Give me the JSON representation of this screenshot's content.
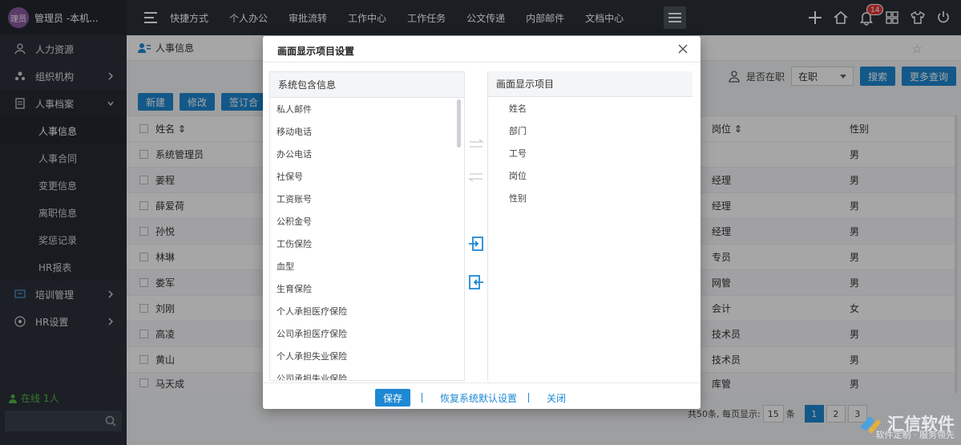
{
  "header": {
    "avatar_text": "理员",
    "user_name": "管理员 -本机...",
    "nav": [
      "快捷方式",
      "个人办公",
      "审批流转",
      "工作中心",
      "工作任务",
      "公文传递",
      "内部邮件",
      "文档中心"
    ],
    "notification_count": "14"
  },
  "sidebar": {
    "items": [
      {
        "label": "人力资源"
      },
      {
        "label": "组织机构"
      },
      {
        "label": "人事档案"
      },
      {
        "label": "培训管理"
      },
      {
        "label": "HR设置"
      }
    ],
    "sub_items": [
      {
        "label": "人事信息"
      },
      {
        "label": "人事合同"
      },
      {
        "label": "变更信息"
      },
      {
        "label": "离职信息"
      },
      {
        "label": "奖惩记录"
      },
      {
        "label": "HR报表"
      }
    ],
    "online_label": "在线",
    "online_count": "1人"
  },
  "main": {
    "breadcrumb": "人事信息",
    "filter_label": "是否在职",
    "filter_value": "在职",
    "search_button": "搜索",
    "more_search_button": "更多查询",
    "toolbar": [
      "新建",
      "修改",
      "签订合"
    ],
    "columns": {
      "name": "姓名",
      "position": "岗位",
      "gender": "性别"
    },
    "rows": [
      {
        "name": "系统管理员",
        "position": "",
        "gender": "男"
      },
      {
        "name": "姜程",
        "position": "经理",
        "gender": "男"
      },
      {
        "name": "薛爱荷",
        "position": "经理",
        "gender": "男"
      },
      {
        "name": "孙悦",
        "position": "经理",
        "gender": "男"
      },
      {
        "name": "林琳",
        "position": "专员",
        "gender": "男"
      },
      {
        "name": "娄军",
        "position": "网管",
        "gender": "男"
      },
      {
        "name": "刘刚",
        "position": "会计",
        "gender": "女"
      },
      {
        "name": "高凌",
        "position": "技术员",
        "gender": "男"
      },
      {
        "name": "黄山",
        "position": "技术员",
        "gender": "男"
      },
      {
        "name": "马天成",
        "position": "库管",
        "gender": "男"
      }
    ],
    "pager": {
      "summary": "共50条, 每页显示:",
      "page_size": "15",
      "unit": "条",
      "pages": [
        "1",
        "2",
        "3"
      ]
    }
  },
  "dialog": {
    "title": "画面显示项目设置",
    "left_header": "系统包含信息",
    "right_header": "画面显示项目",
    "left_items": [
      "私人邮件",
      "移动电话",
      "办公电话",
      "社保号",
      "工资账号",
      "公积金号",
      "工伤保险",
      "血型",
      "生育保险",
      "个人承担医疗保险",
      "公司承担医疗保险",
      "个人承担失业保险",
      "公司承担失业保险"
    ],
    "right_items": [
      "姓名",
      "部门",
      "工号",
      "岗位",
      "性别"
    ],
    "save_button": "保存",
    "restore_link": "恢复系统默认设置",
    "close_link": "关闭"
  },
  "watermark": {
    "brand": "汇信软件",
    "slogan": "软件定制 · 服务领先"
  },
  "colors": {
    "accent": "#1e88d3",
    "topbar": "#2a3038",
    "sidebar": "#2b3139",
    "badge": "#e5383b",
    "online": "#54b848"
  }
}
